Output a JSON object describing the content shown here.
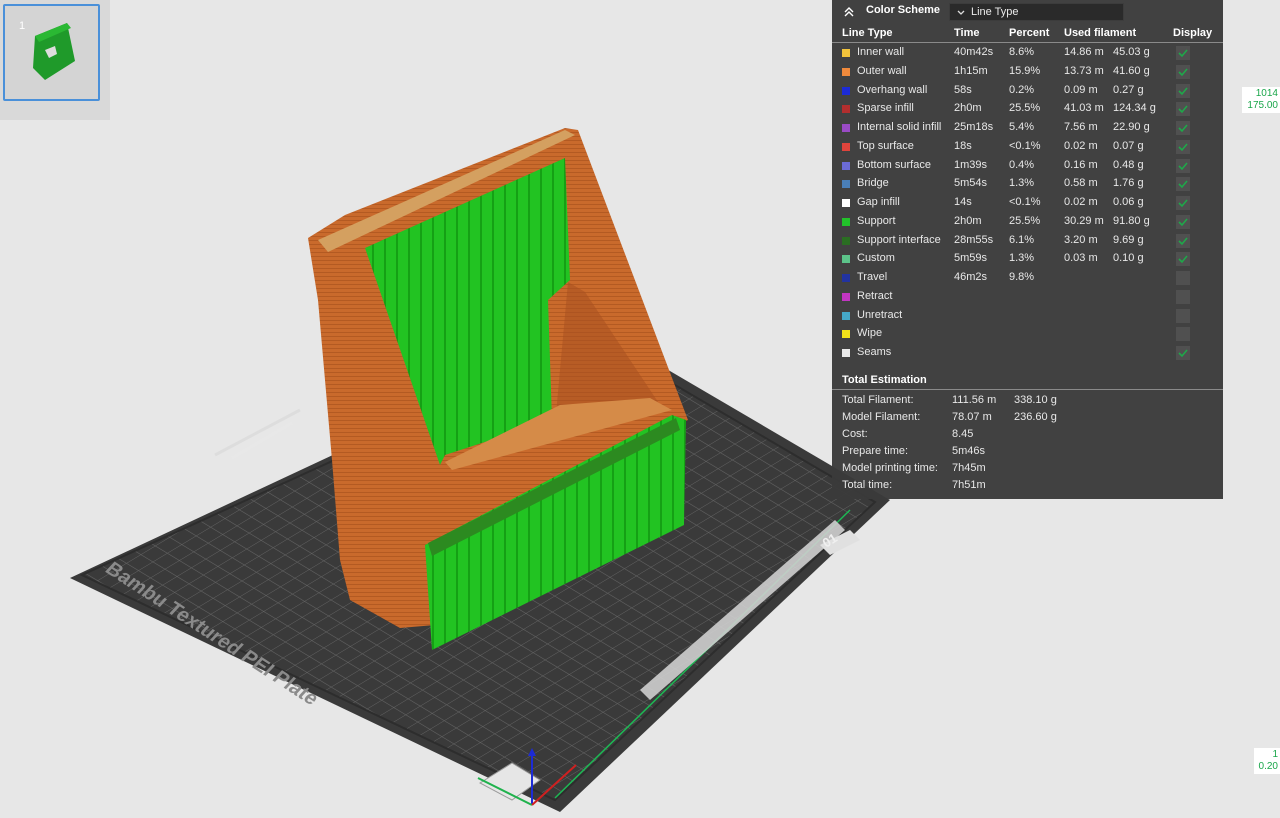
{
  "thumbnail": {
    "number": "1"
  },
  "legend": {
    "title": "Color Scheme",
    "select_value": "Line Type",
    "headers": {
      "line_type": "Line Type",
      "time": "Time",
      "percent": "Percent",
      "used": "Used filament",
      "display": "Display"
    },
    "rows": [
      {
        "name": "Inner wall",
        "color": "#f2c33b",
        "time": "40m42s",
        "percent": "8.6%",
        "meters": "14.86 m",
        "grams": "45.03 g",
        "display": true
      },
      {
        "name": "Outer wall",
        "color": "#f08a3c",
        "time": "1h15m",
        "percent": "15.9%",
        "meters": "13.73 m",
        "grams": "41.60 g",
        "display": true
      },
      {
        "name": "Overhang wall",
        "color": "#1c2bd6",
        "time": "58s",
        "percent": "0.2%",
        "meters": "0.09 m",
        "grams": "0.27 g",
        "display": true
      },
      {
        "name": "Sparse infill",
        "color": "#b22e2e",
        "time": "2h0m",
        "percent": "25.5%",
        "meters": "41.03 m",
        "grams": "124.34 g",
        "display": true
      },
      {
        "name": "Internal solid infill",
        "color": "#9a4bc6",
        "time": "25m18s",
        "percent": "5.4%",
        "meters": "7.56 m",
        "grams": "22.90 g",
        "display": true
      },
      {
        "name": "Top surface",
        "color": "#e0443c",
        "time": "18s",
        "percent": "<0.1%",
        "meters": "0.02 m",
        "grams": "0.07 g",
        "display": true
      },
      {
        "name": "Bottom surface",
        "color": "#6b6bd6",
        "time": "1m39s",
        "percent": "0.4%",
        "meters": "0.16 m",
        "grams": "0.48 g",
        "display": true
      },
      {
        "name": "Bridge",
        "color": "#4a7fb8",
        "time": "5m54s",
        "percent": "1.3%",
        "meters": "0.58 m",
        "grams": "1.76 g",
        "display": true
      },
      {
        "name": "Gap infill",
        "color": "#ffffff",
        "time": "14s",
        "percent": "<0.1%",
        "meters": "0.02 m",
        "grams": "0.06 g",
        "display": true
      },
      {
        "name": "Support",
        "color": "#22c22a",
        "time": "2h0m",
        "percent": "25.5%",
        "meters": "30.29 m",
        "grams": "91.80 g",
        "display": true
      },
      {
        "name": "Support interface",
        "color": "#2a6e22",
        "time": "28m55s",
        "percent": "6.1%",
        "meters": "3.20 m",
        "grams": "9.69 g",
        "display": true
      },
      {
        "name": "Custom",
        "color": "#5cc48a",
        "time": "5m59s",
        "percent": "1.3%",
        "meters": "0.03 m",
        "grams": "0.10 g",
        "display": true
      },
      {
        "name": "Travel",
        "color": "#2233a0",
        "time": "46m2s",
        "percent": "9.8%",
        "meters": "",
        "grams": "",
        "display": false
      },
      {
        "name": "Retract",
        "color": "#c236c2",
        "time": "",
        "percent": "",
        "meters": "",
        "grams": "",
        "display": false
      },
      {
        "name": "Unretract",
        "color": "#45a8c8",
        "time": "",
        "percent": "",
        "meters": "",
        "grams": "",
        "display": false
      },
      {
        "name": "Wipe",
        "color": "#f2e21a",
        "time": "",
        "percent": "",
        "meters": "",
        "grams": "",
        "display": false
      },
      {
        "name": "Seams",
        "color": "#e8e8e8",
        "time": "",
        "percent": "",
        "meters": "",
        "grams": "",
        "display": true
      }
    ],
    "total_title": "Total Estimation",
    "totals": [
      {
        "label": "Total Filament:",
        "value": "111.56 m",
        "value2": "338.10 g"
      },
      {
        "label": "Model Filament:",
        "value": "78.07 m",
        "value2": "236.60 g"
      },
      {
        "label": "Cost:",
        "value": "8.45",
        "value2": ""
      },
      {
        "label": "Prepare time:",
        "value": "5m46s",
        "value2": ""
      },
      {
        "label": "Model printing time:",
        "value": "7h45m",
        "value2": ""
      },
      {
        "label": "Total time:",
        "value": "7h51m",
        "value2": ""
      }
    ]
  },
  "layer_slider": {
    "top_layer": "1014",
    "top_height": "175.00",
    "bottom_layer": "1",
    "bottom_height": "0.20"
  },
  "plate": {
    "name": "Bambu Textured PEI Plate",
    "number": "01"
  },
  "colors": {
    "outer_wall": "#c4632a",
    "support": "#1fc21f",
    "plate": "#3a3a3a",
    "grid": "#5a5a5a"
  }
}
